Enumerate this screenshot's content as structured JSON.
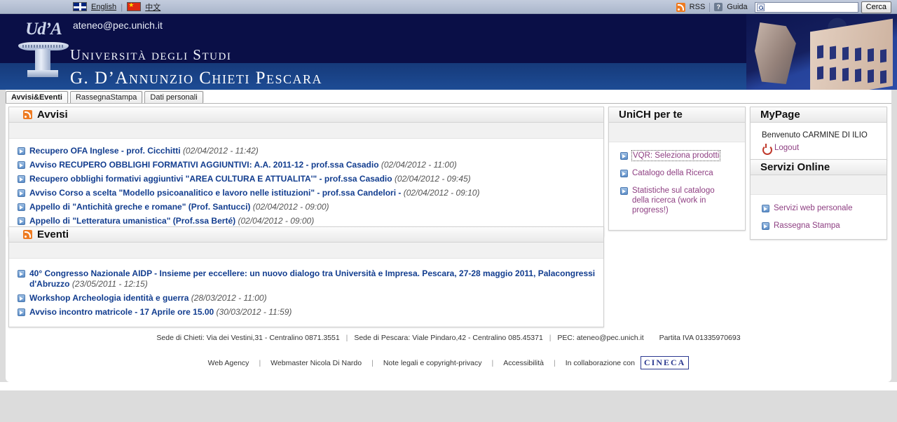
{
  "topbar": {
    "languages": [
      {
        "icon": "uk-flag-icon",
        "label": "English"
      },
      {
        "icon": "cn-flag-icon",
        "label": "中文"
      }
    ],
    "separator": "|",
    "rss_label": "RSS",
    "help_label": "Guida",
    "help_icon": "question-mark-icon",
    "search": {
      "value": "",
      "placeholder": "",
      "button_label": "Cerca",
      "icon": "search-icon"
    }
  },
  "masthead": {
    "pec_email": "ateneo@pec.unich.it",
    "title_line1": "Università degli Studi",
    "title_line2": "G. D’Annunzio Chieti Pescara",
    "logo_text": "Ud’A",
    "colors": {
      "dark_navy": "#0a0f47",
      "band_blue": "#1d4c95",
      "topbar": "#b6c1d6"
    }
  },
  "tabs": [
    {
      "label": "Avvisi&Eventi",
      "active": true
    },
    {
      "label": "RassegnaStampa",
      "active": false
    },
    {
      "label": "Dati personali",
      "active": false
    }
  ],
  "avvisi": {
    "title": "Avvisi",
    "icon": "rss-icon",
    "items": [
      {
        "title": "Recupero OFA Inglese - prof. Cicchitti",
        "date": "(02/04/2012 - 11:42)"
      },
      {
        "title": "Avviso RECUPERO OBBLIGHI FORMATIVI AGGIUNTIVI: A.A. 2011-12 - prof.ssa Casadio",
        "date": "(02/04/2012 - 11:00)"
      },
      {
        "title": "Recupero obblighi formativi aggiuntivi \"AREA CULTURA E ATTUALITA'\" - prof.ssa Casadio",
        "date": "(02/04/2012 - 09:45)"
      },
      {
        "title": "Avviso Corso a scelta \"Modello psicoanalitico e lavoro nelle istituzioni\" - prof.ssa Candelori -",
        "date": "(02/04/2012 - 09:10)"
      },
      {
        "title": "Appello di \"Antichità greche e romane\" (Prof. Santucci)",
        "date": "(02/04/2012 - 09:00)"
      },
      {
        "title": "Appello di \"Letteratura umanistica\" (Prof.ssa Berté)",
        "date": "(02/04/2012 - 09:00)"
      }
    ]
  },
  "eventi": {
    "title": "Eventi",
    "icon": "rss-icon",
    "items": [
      {
        "title": "40° Congresso Nazionale AIDP - Insieme per eccellere: un nuovo dialogo tra Università e Impresa. Pescara, 27-28 maggio 2011, Palacongressi d'Abruzzo",
        "date": "(23/05/2011 - 12:15)"
      },
      {
        "title": "Workshop Archeologia identità e guerra",
        "date": "(28/03/2012 - 11:00)"
      },
      {
        "title": "Avviso incontro matricole - 17 Aprile ore 15.00",
        "date": "(30/03/2012 - 11:59)"
      }
    ]
  },
  "unich_per_te": {
    "title": "UniCH per te",
    "links": [
      {
        "label": "VQR: Seleziona prodotti",
        "focused": true
      },
      {
        "label": "Catalogo della Ricerca",
        "focused": false
      },
      {
        "label": "Statistiche sul catalogo della ricerca (work in progress!)",
        "focused": false
      }
    ]
  },
  "mypage": {
    "title": "MyPage",
    "welcome": "Benvenuto CARMINE DI ILIO",
    "logout_label": "Logout",
    "logout_icon": "power-icon"
  },
  "servizi_online": {
    "title": "Servizi Online",
    "links": [
      {
        "label": "Servizi web personale"
      },
      {
        "label": "Rassegna Stampa"
      }
    ]
  },
  "footer": {
    "line1": {
      "chieti": "Sede di Chieti: Via dei Vestini,31 - Centralino 0871.3551",
      "pescara": "Sede di Pescara: Viale Pindaro,42 - Centralino 085.45371",
      "pec": "PEC: ateneo@pec.unich.it",
      "piva": "Partita IVA 01335970693"
    },
    "line2": {
      "web_agency": "Web Agency",
      "webmaster": "Webmaster Nicola Di Nardo",
      "legal": "Note legali e copyright-privacy",
      "accessibility": "Accessibilità",
      "collab": "In collaborazione con",
      "cineca": "CINECA"
    }
  }
}
